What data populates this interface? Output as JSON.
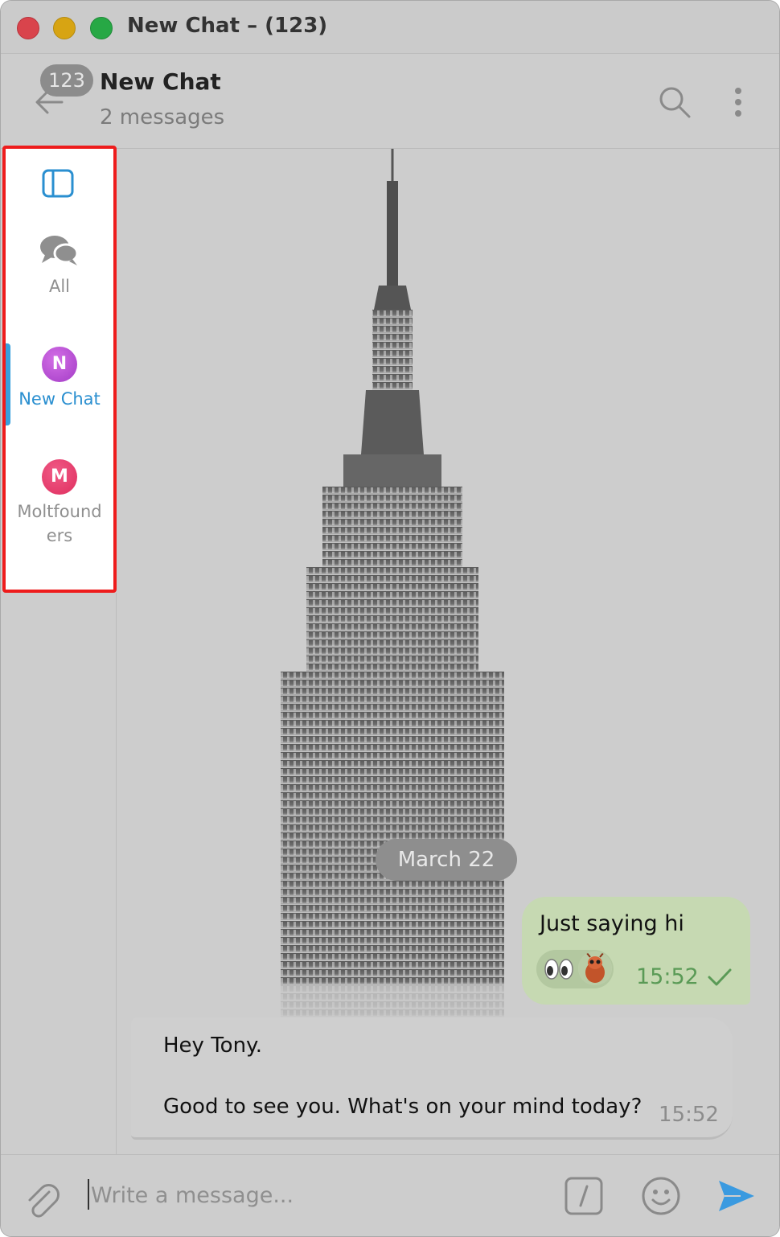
{
  "window": {
    "title": "New Chat – (123)"
  },
  "header": {
    "unread_count": "123",
    "title": "New Chat",
    "subtitle": "2 messages"
  },
  "sidebar": {
    "folders": [
      {
        "label": "All",
        "icon": "chat-bubbles-icon",
        "active": false
      },
      {
        "label": "New Chat",
        "avatar_letter": "N",
        "color": "#b04ccf",
        "active": true
      },
      {
        "label": "Moltfound\ners",
        "avatar_letter": "M",
        "color": "#e43a68",
        "active": false
      }
    ],
    "accent_color": "#2a8fd0"
  },
  "chat": {
    "date_separator": "March 22",
    "messages": [
      {
        "direction": "outgoing",
        "text": "Just saying hi",
        "reactions": [
          "eyes-emoji",
          "user-avatar"
        ],
        "time": "15:52",
        "status": "sent-check"
      },
      {
        "direction": "incoming",
        "line1": "Hey Tony.",
        "line2": "Good to see you. What's on your mind today?",
        "time": "15:52"
      }
    ]
  },
  "composer": {
    "placeholder": "Write a message..."
  },
  "colors": {
    "outgoing_bubble": "#c6d9b2",
    "send_icon": "#3a9ae0",
    "selection_outline": "#ee1c1c"
  }
}
